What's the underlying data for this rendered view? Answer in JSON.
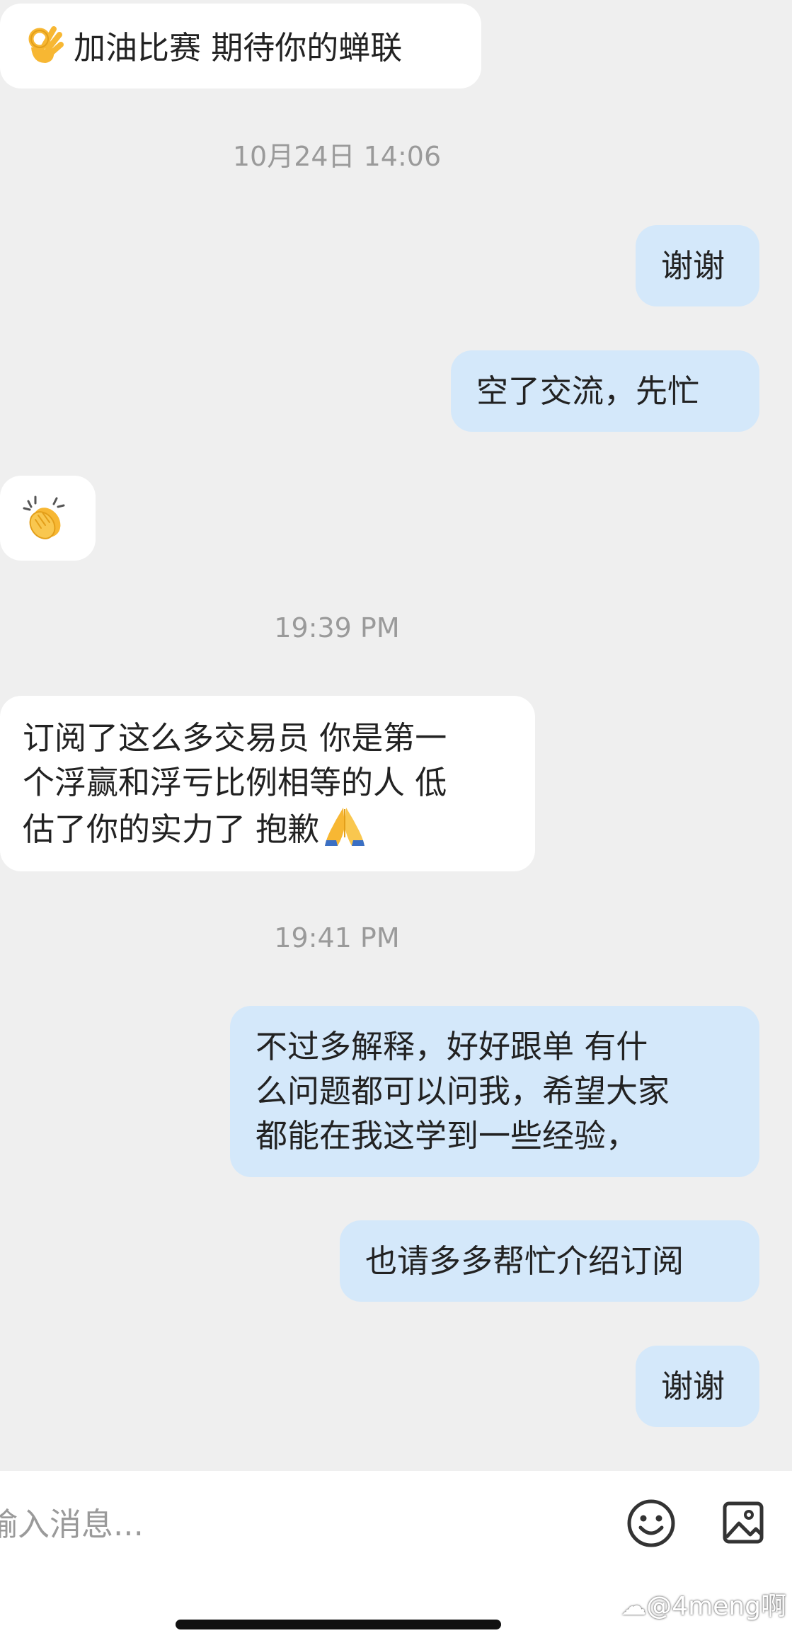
{
  "messages": [
    {
      "text": "加油比赛 期待你的蝉联",
      "emoji": "ok-hand"
    },
    {
      "timestamp": "10月24日 14:06"
    },
    {
      "text": "谢谢"
    },
    {
      "text": "空了交流，先忙"
    },
    {
      "emoji": "clapping-hands"
    },
    {
      "timestamp": "19:39 PM"
    },
    {
      "lines": [
        "订阅了这么多交易员 你是第一",
        "个浮赢和浮亏比例相等的人 低",
        "估了你的实力了 抱歉"
      ],
      "emoji": "folded-hands"
    },
    {
      "timestamp": "19:41 PM"
    },
    {
      "lines": [
        "不过多解释，好好跟单  有什",
        "么问题都可以问我，希望大家",
        "都能在我这学到一些经验，"
      ]
    },
    {
      "text": "也请多多帮忙介绍订阅"
    },
    {
      "text": "谢谢"
    }
  ],
  "input": {
    "placeholder": "输入消息..."
  },
  "icons": {
    "emoji_button": "smiley-icon",
    "image_button": "image-icon"
  },
  "watermark": "@4meng啊",
  "colors": {
    "background": "#efefef",
    "incoming": "#ffffff",
    "outgoing": "#d4e8fa",
    "timestamp": "#9a9a9a"
  }
}
